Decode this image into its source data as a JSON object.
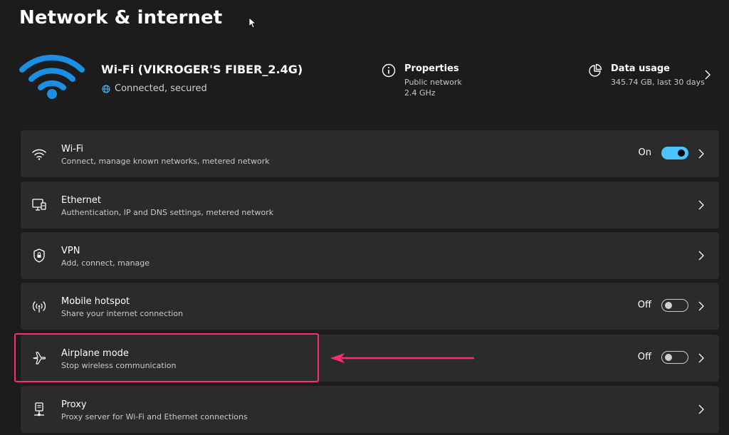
{
  "page": {
    "title": "Network & internet"
  },
  "hero": {
    "network_name": "Wi-Fi (VIKROGER'S FIBER_2.4G)",
    "status": "Connected, secured",
    "properties": {
      "title": "Properties",
      "line1": "Public network",
      "line2": "2.4 GHz"
    },
    "data_usage": {
      "title": "Data usage",
      "value": "345.74 GB, last 30 days"
    }
  },
  "rows": [
    {
      "title": "Wi-Fi",
      "subtitle": "Connect, manage known networks, metered network",
      "toggle_label": "On",
      "toggle_state": "on",
      "icon": "wifi-icon"
    },
    {
      "title": "Ethernet",
      "subtitle": "Authentication, IP and DNS settings, metered network",
      "icon": "ethernet-icon"
    },
    {
      "title": "VPN",
      "subtitle": "Add, connect, manage",
      "icon": "vpn-shield-icon"
    },
    {
      "title": "Mobile hotspot",
      "subtitle": "Share your internet connection",
      "toggle_label": "Off",
      "toggle_state": "off",
      "icon": "hotspot-icon"
    },
    {
      "title": "Airplane mode",
      "subtitle": "Stop wireless communication",
      "toggle_label": "Off",
      "toggle_state": "off",
      "icon": "airplane-icon"
    },
    {
      "title": "Proxy",
      "subtitle": "Proxy server for Wi-Fi and Ethernet connections",
      "icon": "proxy-icon"
    }
  ],
  "colors": {
    "background": "#1c1c1c",
    "card": "#2b2b2b",
    "accent": "#4cc2ff",
    "hero_wifi": "#1a8fe3",
    "annotation": "#ff2d6e"
  }
}
